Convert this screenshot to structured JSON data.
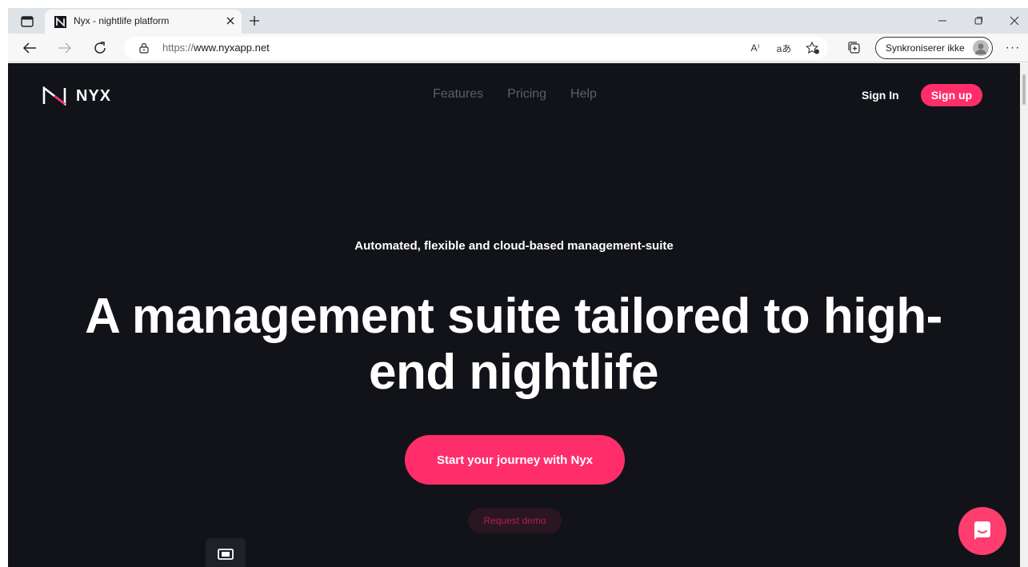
{
  "browser": {
    "tab_title": "Nyx - nightlife platform",
    "url_scheme": "https://",
    "url_host": "www.nyxapp.net",
    "read_aloud_label": "A⁾",
    "translate_label": "aあ",
    "sync_label": "Synkroniserer ikke",
    "more_label": "···"
  },
  "site": {
    "logo_text": "NYX",
    "nav": [
      "Features",
      "Pricing",
      "Help"
    ],
    "sign_in": "Sign In",
    "sign_up": "Sign up"
  },
  "hero": {
    "eyebrow": "Automated, flexible and cloud-based management-suite",
    "headline": "A management suite tailored to high-end nightlife",
    "cta": "Start your journey with Nyx",
    "demo": "Request demo"
  },
  "colors": {
    "page_bg": "#111318",
    "accent": "#ff2e6a",
    "nav_text": "#5b5f68",
    "demo_bg": "#2a1620",
    "demo_text": "#b0204f"
  },
  "icons": {
    "tabs": "tab-actions-icon",
    "close": "close-icon",
    "new_tab": "plus-icon",
    "back": "back-arrow-icon",
    "forward": "forward-arrow-icon",
    "refresh": "refresh-icon",
    "favorite": "favorite-star-icon",
    "collections": "collections-icon",
    "chat": "chat-bubble-icon",
    "ticket": "ticket-icon"
  }
}
